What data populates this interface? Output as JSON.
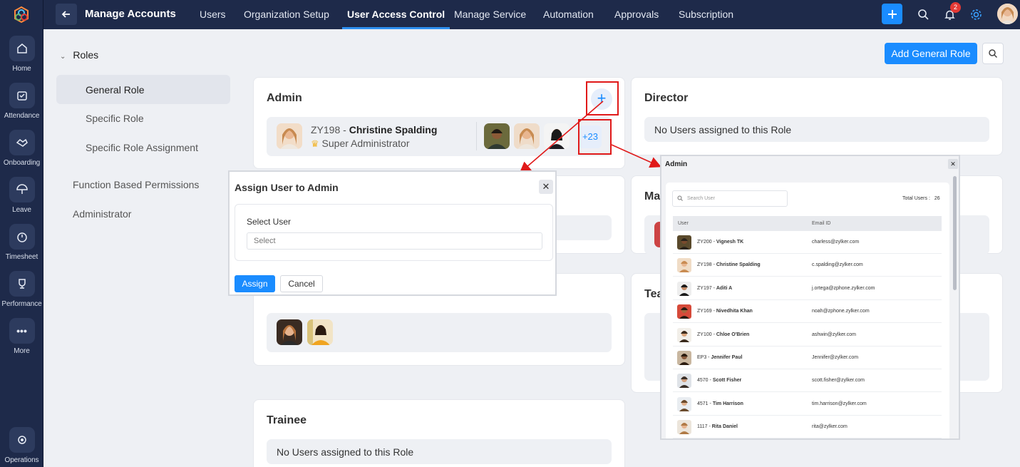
{
  "rail": {
    "items": [
      {
        "label": "Home",
        "icon": "home-icon"
      },
      {
        "label": "Attendance",
        "icon": "calendar-icon"
      },
      {
        "label": "Onboarding",
        "icon": "handshake-icon"
      },
      {
        "label": "Leave",
        "icon": "umbrella-icon"
      },
      {
        "label": "Timesheet",
        "icon": "timer-icon"
      },
      {
        "label": "Performance",
        "icon": "trophy-icon"
      },
      {
        "label": "More",
        "icon": "more-dots-icon"
      }
    ],
    "bottom": {
      "label": "Operations",
      "icon": "operations-icon"
    }
  },
  "topbar": {
    "title": "Manage Accounts",
    "nav": [
      "Users",
      "Organization Setup",
      "User Access Control",
      "Manage Service",
      "Automation",
      "Approvals",
      "Subscription"
    ],
    "active_nav": "User Access Control",
    "notification_count": "2"
  },
  "roles_nav": {
    "heading": "Roles",
    "items": [
      "General Role",
      "Specific Role",
      "Specific Role Assignment"
    ],
    "other": [
      "Function Based Permissions",
      "Administrator"
    ]
  },
  "actions": {
    "add_role": "Add General Role"
  },
  "cards": {
    "admin": {
      "title": "Admin",
      "user_id": "ZY198",
      "sep": " - ",
      "user_name": "Christine Spalding",
      "user_role": "Super Administrator",
      "more": "+23"
    },
    "director": {
      "title": "Director",
      "empty": "No Users assigned to this Role"
    },
    "manager": {
      "title": "Ma"
    },
    "team": {
      "title": "Tea"
    },
    "trainee": {
      "title": "Trainee",
      "empty": "No Users assigned to this Role"
    }
  },
  "dialog": {
    "title": "Assign User to Admin",
    "field_label": "Select User",
    "placeholder": "Select",
    "assign": "Assign",
    "cancel": "Cancel"
  },
  "popup": {
    "title": "Admin",
    "search_placeholder": "Search User",
    "total_label": "Total Users :",
    "total_value": "26",
    "col_user": "User",
    "col_email": "Email ID",
    "rows": [
      {
        "id": "ZY200",
        "name": "Vignesh TK",
        "email": "charless@zylker.com"
      },
      {
        "id": "ZY198",
        "name": "Christine Spalding",
        "email": "c.spalding@zylker.com"
      },
      {
        "id": "ZY197",
        "name": "Aditi A",
        "email": "j.ortega@zphone.zylker.com"
      },
      {
        "id": "ZY169",
        "name": "Nivedhita Khan",
        "email": "noah@zphone.zylker.com"
      },
      {
        "id": "ZY100",
        "name": "Chloe O'Brien",
        "email": "ashwin@zylker.com"
      },
      {
        "id": "EP3",
        "name": "Jennifer Paul",
        "email": "Jennifer@zylker.com"
      },
      {
        "id": "4570",
        "name": "Scott Fisher",
        "email": "scott.fisher@zylker.com"
      },
      {
        "id": "4571",
        "name": "Tim Harrison",
        "email": "tim.harrison@zylker.com"
      },
      {
        "id": "1117",
        "name": "Rita Daniel",
        "email": "rita@zylker.com"
      }
    ]
  },
  "colors": {
    "rail": "#1e2a4a",
    "accent": "#1a8cff",
    "highlight": "#e01919"
  }
}
